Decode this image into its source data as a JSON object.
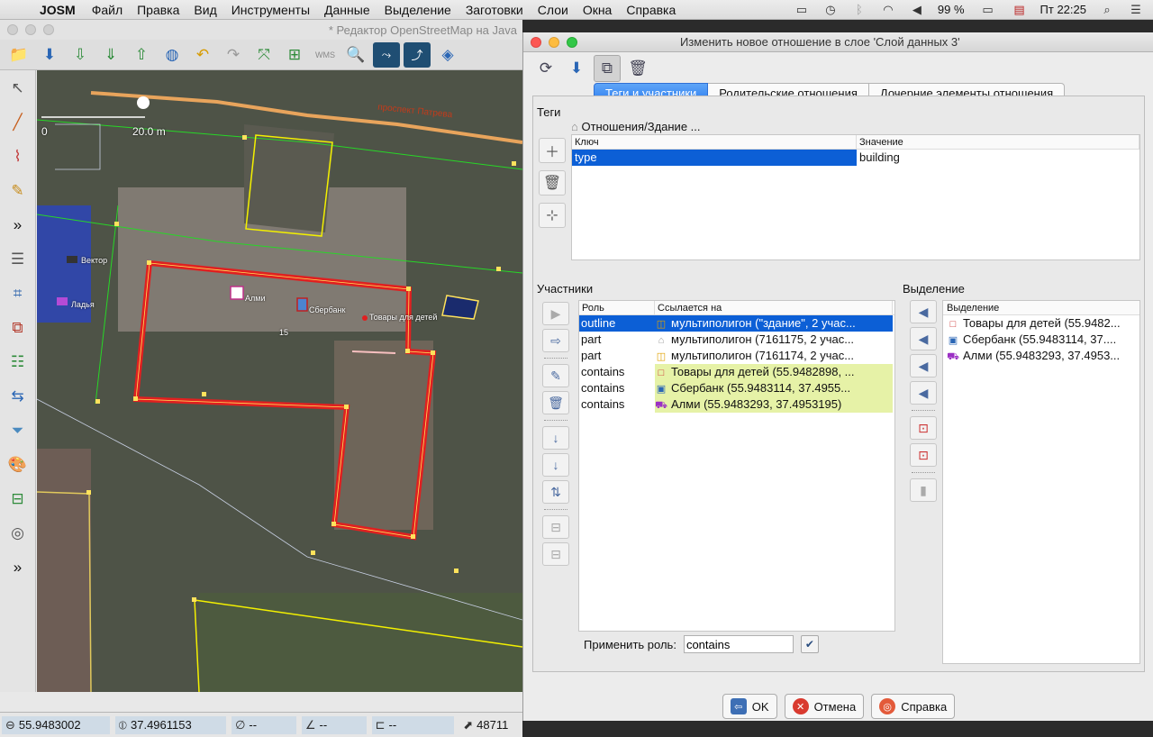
{
  "menubar": {
    "app_name": "JOSM",
    "items": [
      "Файл",
      "Правка",
      "Вид",
      "Инструменты",
      "Данные",
      "Выделение",
      "Заготовки",
      "Слои",
      "Окна",
      "Справка"
    ],
    "battery": "99 %",
    "clock": "Пт 22:25"
  },
  "josm": {
    "window_title": "* Редактор OpenStreetMap на Java",
    "map": {
      "scale_zero": "0",
      "scale_label": "20.0 m",
      "street_label": "проспект Патрева",
      "poi_vector": "Вектор",
      "poi_ladya": "Ладья",
      "poi_almi": "Алми",
      "poi_sberbank": "Сбербанк",
      "poi_tovary": "Товары для детей",
      "house_number": "15"
    },
    "status": {
      "lat": "55.9483002",
      "lon": "37.4961153",
      "heading": "--",
      "angle": "--",
      "length": "--",
      "id": "48711"
    }
  },
  "dialog": {
    "title": "Изменить новое отношение в слое 'Слой данных 3'",
    "tabs": [
      "Теги и участники",
      "Родительские отношения",
      "Дочерние элементы отношения"
    ],
    "tags": {
      "section_title": "Теги",
      "breadcrumb": "Отношения/Здание ...",
      "col_key": "Ключ",
      "col_value": "Значение",
      "rows": [
        {
          "key": "type",
          "value": "building"
        }
      ]
    },
    "members": {
      "section_title": "Участники",
      "col_role": "Роль",
      "col_ref": "Ссылается на",
      "rows": [
        {
          "role": "outline",
          "ref": "мультиполигон (\"здание\", 2 учас...",
          "icon": "multipolygon-yellow-icon",
          "style": "selected"
        },
        {
          "role": "part",
          "ref": "мультиполигон (7161175, 2 учас...",
          "icon": "house-icon",
          "style": "plain"
        },
        {
          "role": "part",
          "ref": "мультиполигон (7161174, 2 учас...",
          "icon": "multipolygon-yellow-icon",
          "style": "plain"
        },
        {
          "role": "contains",
          "ref": "Товары для детей (55.9482898, ...",
          "icon": "node-icon",
          "style": "yellow"
        },
        {
          "role": "contains",
          "ref": "Сбербанк (55.9483114, 37.4955...",
          "icon": "bank-icon",
          "style": "yellow"
        },
        {
          "role": "contains",
          "ref": "Алми (55.9483293, 37.4953195)",
          "icon": "cart-icon",
          "style": "yellow"
        }
      ],
      "apply_role_label": "Применить роль:",
      "apply_role_value": "contains"
    },
    "selection": {
      "section_title": "Выделение",
      "list_header": "Выделение",
      "rows": [
        {
          "text": "Товары для детей (55.9482...",
          "icon": "node-icon"
        },
        {
          "text": "Сбербанк (55.9483114, 37....",
          "icon": "bank-icon"
        },
        {
          "text": "Алми (55.9483293, 37.4953...",
          "icon": "cart-icon"
        }
      ]
    },
    "buttons": {
      "ok": "OK",
      "cancel": "Отмена",
      "help": "Справка"
    }
  },
  "colors": {
    "selection_blue": "#0c5fd6",
    "member_highlight": "#e6f2a7",
    "relation_outline": "#e02020",
    "way_yellow": "#f3f000",
    "way_green": "#22dd22"
  }
}
